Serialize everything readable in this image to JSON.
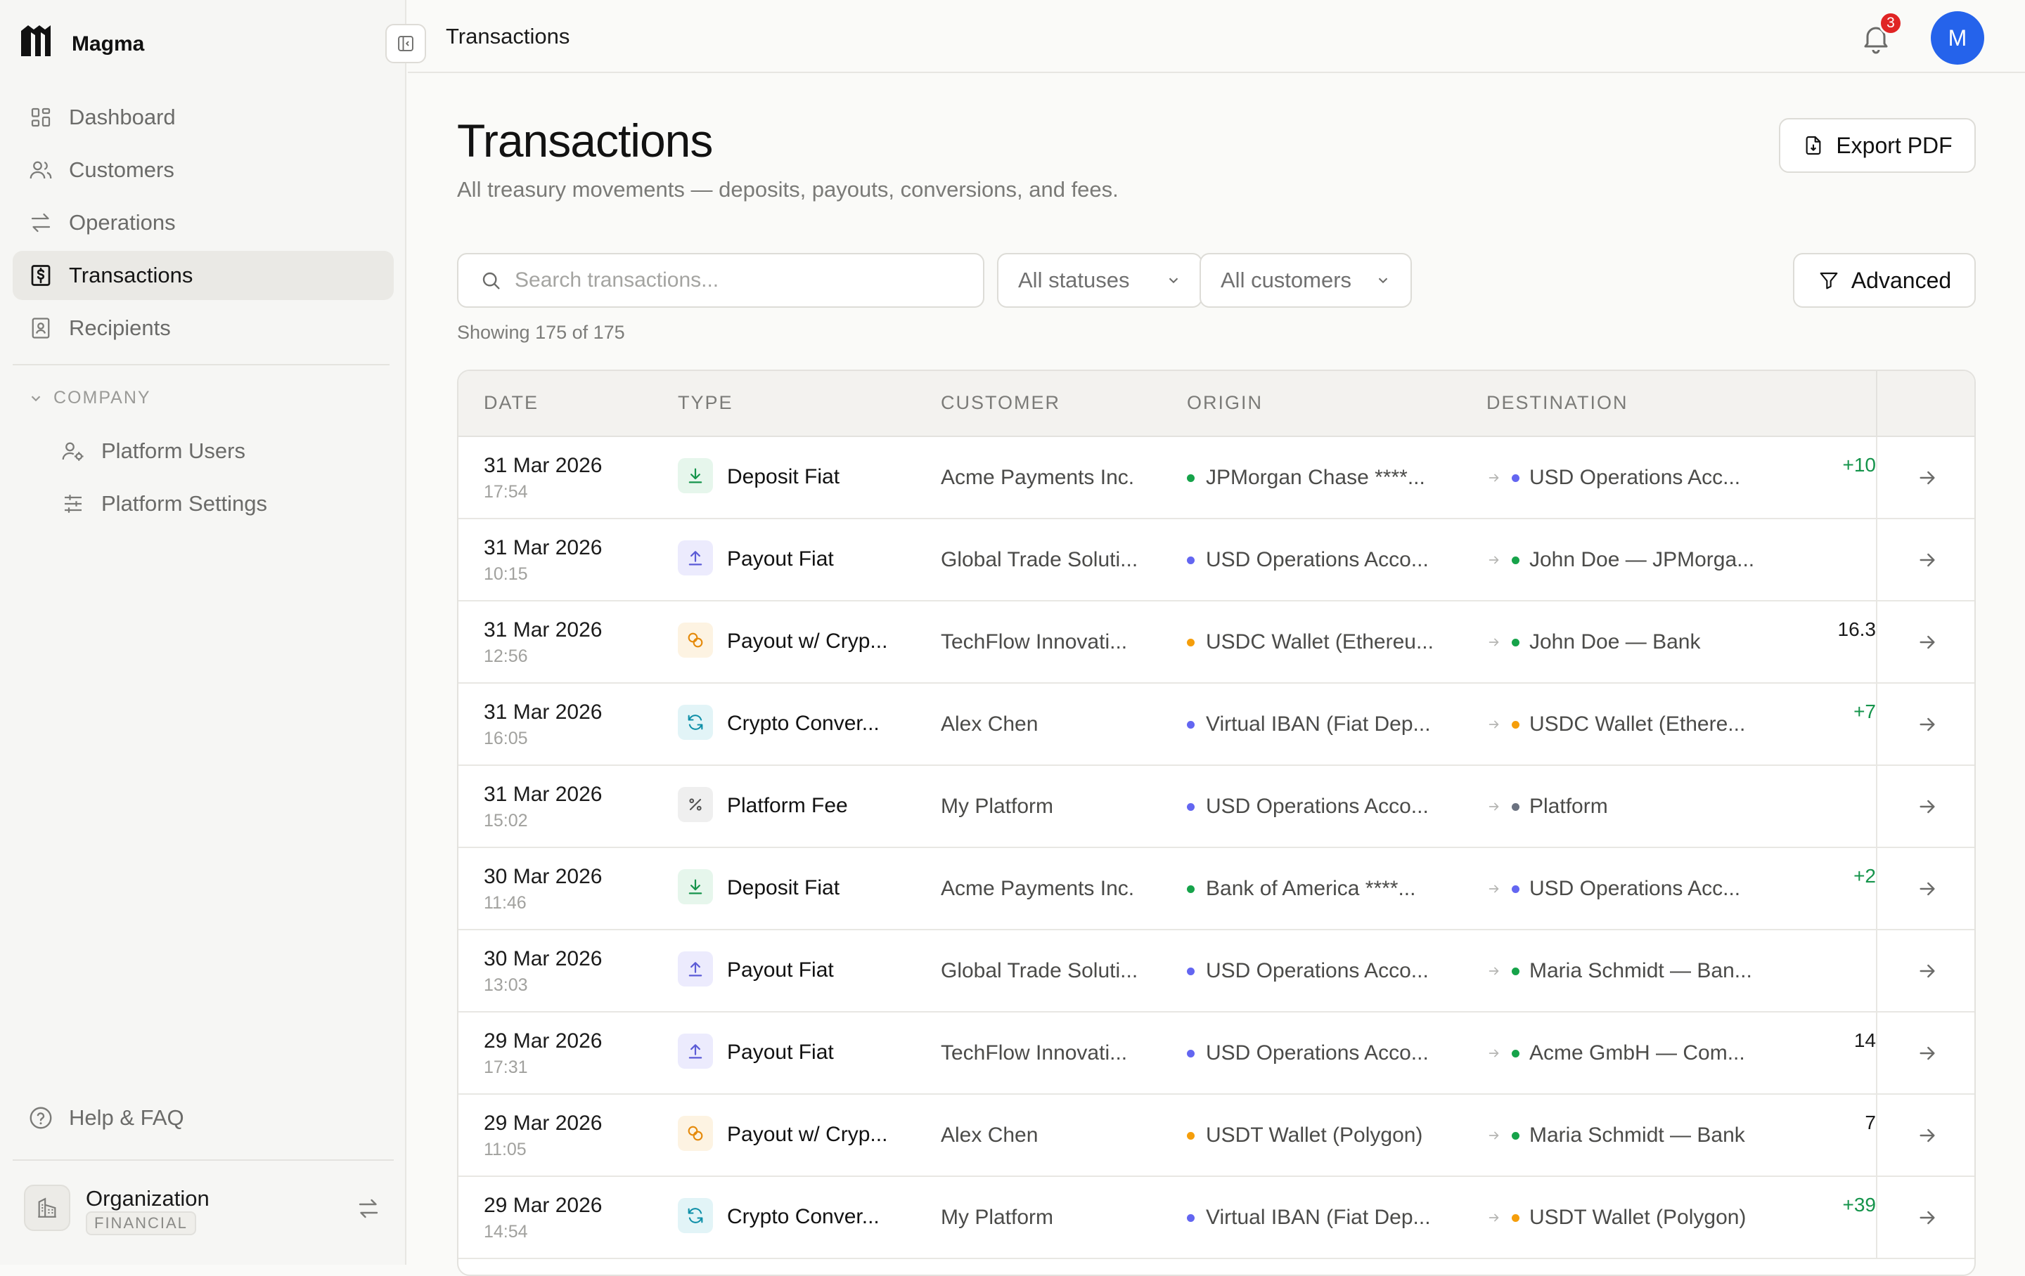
{
  "brand": {
    "name": "Magma"
  },
  "sidebar": {
    "items": [
      {
        "label": "Dashboard",
        "icon": "dashboard-icon"
      },
      {
        "label": "Customers",
        "icon": "users-icon"
      },
      {
        "label": "Operations",
        "icon": "arrows-icon"
      },
      {
        "label": "Transactions",
        "icon": "dollar-icon",
        "active": true
      },
      {
        "label": "Recipients",
        "icon": "contact-icon"
      }
    ],
    "section_label": "COMPANY",
    "company_items": [
      {
        "label": "Platform Users",
        "icon": "user-gear-icon"
      },
      {
        "label": "Platform Settings",
        "icon": "sliders-icon"
      }
    ],
    "help_label": "Help & FAQ",
    "org": {
      "name": "Organization",
      "badge": "FINANCIAL"
    }
  },
  "topbar": {
    "title": "Transactions",
    "notifications": "3",
    "avatar_initial": "M"
  },
  "page": {
    "title": "Transactions",
    "subtitle": "All treasury movements — deposits, payouts, conversions, and fees.",
    "export_label": "Export PDF",
    "advanced_label": "Advanced",
    "search_placeholder": "Search transactions...",
    "status_filter": "All statuses",
    "customer_filter": "All customers",
    "showing": "Showing 175 of 175"
  },
  "colors": {
    "accent": "#2563eb",
    "positive": "#15944b",
    "dot_green": "#16a34a",
    "dot_blue": "#6366f1",
    "dot_orange": "#f59e0b",
    "dot_gray": "#6b7280"
  },
  "table": {
    "headers": {
      "date": "DATE",
      "type": "TYPE",
      "customer": "CUSTOMER",
      "origin": "ORIGIN",
      "destination": "DESTINATION"
    },
    "rows": [
      {
        "date": "31 Mar 2026",
        "time": "17:54",
        "type": "Deposit Fiat",
        "kind": "deposit",
        "customer": "Acme Payments Inc.",
        "origin": "JPMorgan Chase ****...",
        "origin_dot": "green",
        "destination": "USD Operations Acc...",
        "dest_dot": "blue",
        "amount": "+10",
        "amount_sign": "pos"
      },
      {
        "date": "31 Mar 2026",
        "time": "10:15",
        "type": "Payout Fiat",
        "kind": "payout",
        "customer": "Global Trade Soluti...",
        "origin": "USD Operations Acco...",
        "origin_dot": "blue",
        "destination": "John Doe — JPMorga...",
        "dest_dot": "green",
        "amount": "",
        "amount_sign": "neg"
      },
      {
        "date": "31 Mar 2026",
        "time": "12:56",
        "type": "Payout w/ Cryp...",
        "kind": "crypto",
        "customer": "TechFlow Innovati...",
        "origin": "USDC Wallet (Ethereu...",
        "origin_dot": "orange",
        "destination": "John Doe — Bank",
        "dest_dot": "green",
        "amount": "16.3",
        "amount_sign": "neg"
      },
      {
        "date": "31 Mar 2026",
        "time": "16:05",
        "type": "Crypto Conver...",
        "kind": "convert",
        "customer": "Alex Chen",
        "origin": "Virtual IBAN (Fiat Dep...",
        "origin_dot": "blue",
        "destination": "USDC Wallet (Ethere...",
        "dest_dot": "orange",
        "amount": "+7",
        "amount_sign": "pos"
      },
      {
        "date": "31 Mar 2026",
        "time": "15:02",
        "type": "Platform Fee",
        "kind": "fee",
        "customer": "My Platform",
        "origin": "USD Operations Acco...",
        "origin_dot": "blue",
        "destination": "Platform",
        "dest_dot": "gray",
        "amount": "",
        "amount_sign": "neg"
      },
      {
        "date": "30 Mar 2026",
        "time": "11:46",
        "type": "Deposit Fiat",
        "kind": "deposit",
        "customer": "Acme Payments Inc.",
        "origin": "Bank of America ****...",
        "origin_dot": "green",
        "destination": "USD Operations Acc...",
        "dest_dot": "blue",
        "amount": "+2",
        "amount_sign": "pos"
      },
      {
        "date": "30 Mar 2026",
        "time": "13:03",
        "type": "Payout Fiat",
        "kind": "payout",
        "customer": "Global Trade Soluti...",
        "origin": "USD Operations Acco...",
        "origin_dot": "blue",
        "destination": "Maria Schmidt — Ban...",
        "dest_dot": "green",
        "amount": "",
        "amount_sign": "neg"
      },
      {
        "date": "29 Mar 2026",
        "time": "17:31",
        "type": "Payout Fiat",
        "kind": "payout",
        "customer": "TechFlow Innovati...",
        "origin": "USD Operations Acco...",
        "origin_dot": "blue",
        "destination": "Acme GmbH — Com...",
        "dest_dot": "green",
        "amount": "14",
        "amount_sign": "neg"
      },
      {
        "date": "29 Mar 2026",
        "time": "11:05",
        "type": "Payout w/ Cryp...",
        "kind": "crypto",
        "customer": "Alex Chen",
        "origin": "USDT Wallet (Polygon)",
        "origin_dot": "orange",
        "destination": "Maria Schmidt — Bank",
        "dest_dot": "green",
        "amount": "7",
        "amount_sign": "neg"
      },
      {
        "date": "29 Mar 2026",
        "time": "14:54",
        "type": "Crypto Conver...",
        "kind": "convert",
        "customer": "My Platform",
        "origin": "Virtual IBAN (Fiat Dep...",
        "origin_dot": "blue",
        "destination": "USDT Wallet (Polygon)",
        "dest_dot": "orange",
        "amount": "+39",
        "amount_sign": "pos"
      }
    ]
  }
}
